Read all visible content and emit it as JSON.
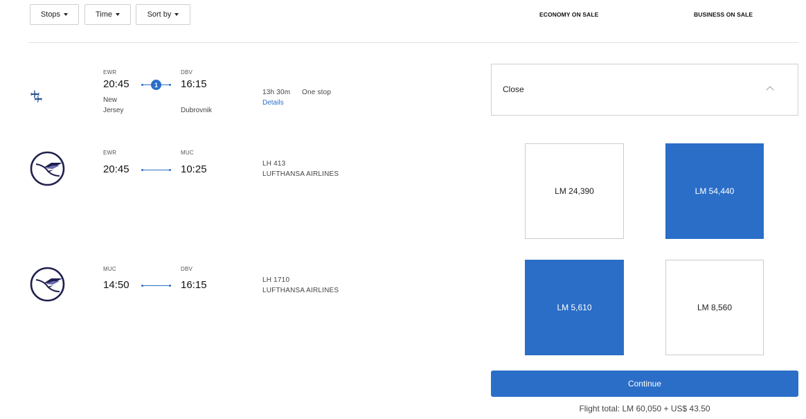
{
  "filters": {
    "stops_label": "Stops",
    "time_label": "Time",
    "sort_label": "Sort by"
  },
  "columns": {
    "economy": "ECONOMY ON SALE",
    "business": "BUSINESS ON SALE"
  },
  "itinerary": {
    "depart_code": "EWR",
    "depart_time": "20:45",
    "depart_city": "New Jersey",
    "arrive_code": "DBV",
    "arrive_time": "16:15",
    "arrive_city": "Dubrovnik",
    "stops_count": "1",
    "duration": "13h 30m",
    "stops_text": "One stop",
    "details_link": "Details",
    "close_label": "Close"
  },
  "segments": [
    {
      "depart_code": "EWR",
      "depart_time": "20:45",
      "arrive_code": "MUC",
      "arrive_time": "10:25",
      "flight_no": "LH 413",
      "airline": "LUFTHANSA AIRLINES",
      "economy_fare": "LM 24,390",
      "business_fare": "LM 54,440",
      "selected": "business"
    },
    {
      "depart_code": "MUC",
      "depart_time": "14:50",
      "arrive_code": "DBV",
      "arrive_time": "16:15",
      "flight_no": "LH 1710",
      "airline": "LUFTHANSA AIRLINES",
      "economy_fare": "LM 5,610",
      "business_fare": "LM 8,560",
      "selected": "economy"
    }
  ],
  "footer": {
    "continue_label": "Continue",
    "flight_total": "Flight total: LM 60,050 + US$ 43.50"
  },
  "colors": {
    "accent": "#2a6ec8",
    "logo_navy": "#1e1f4f"
  },
  "icons": {
    "connection": "connecting-flights-icon",
    "airline_logo": "lufthansa-crane-logo"
  }
}
